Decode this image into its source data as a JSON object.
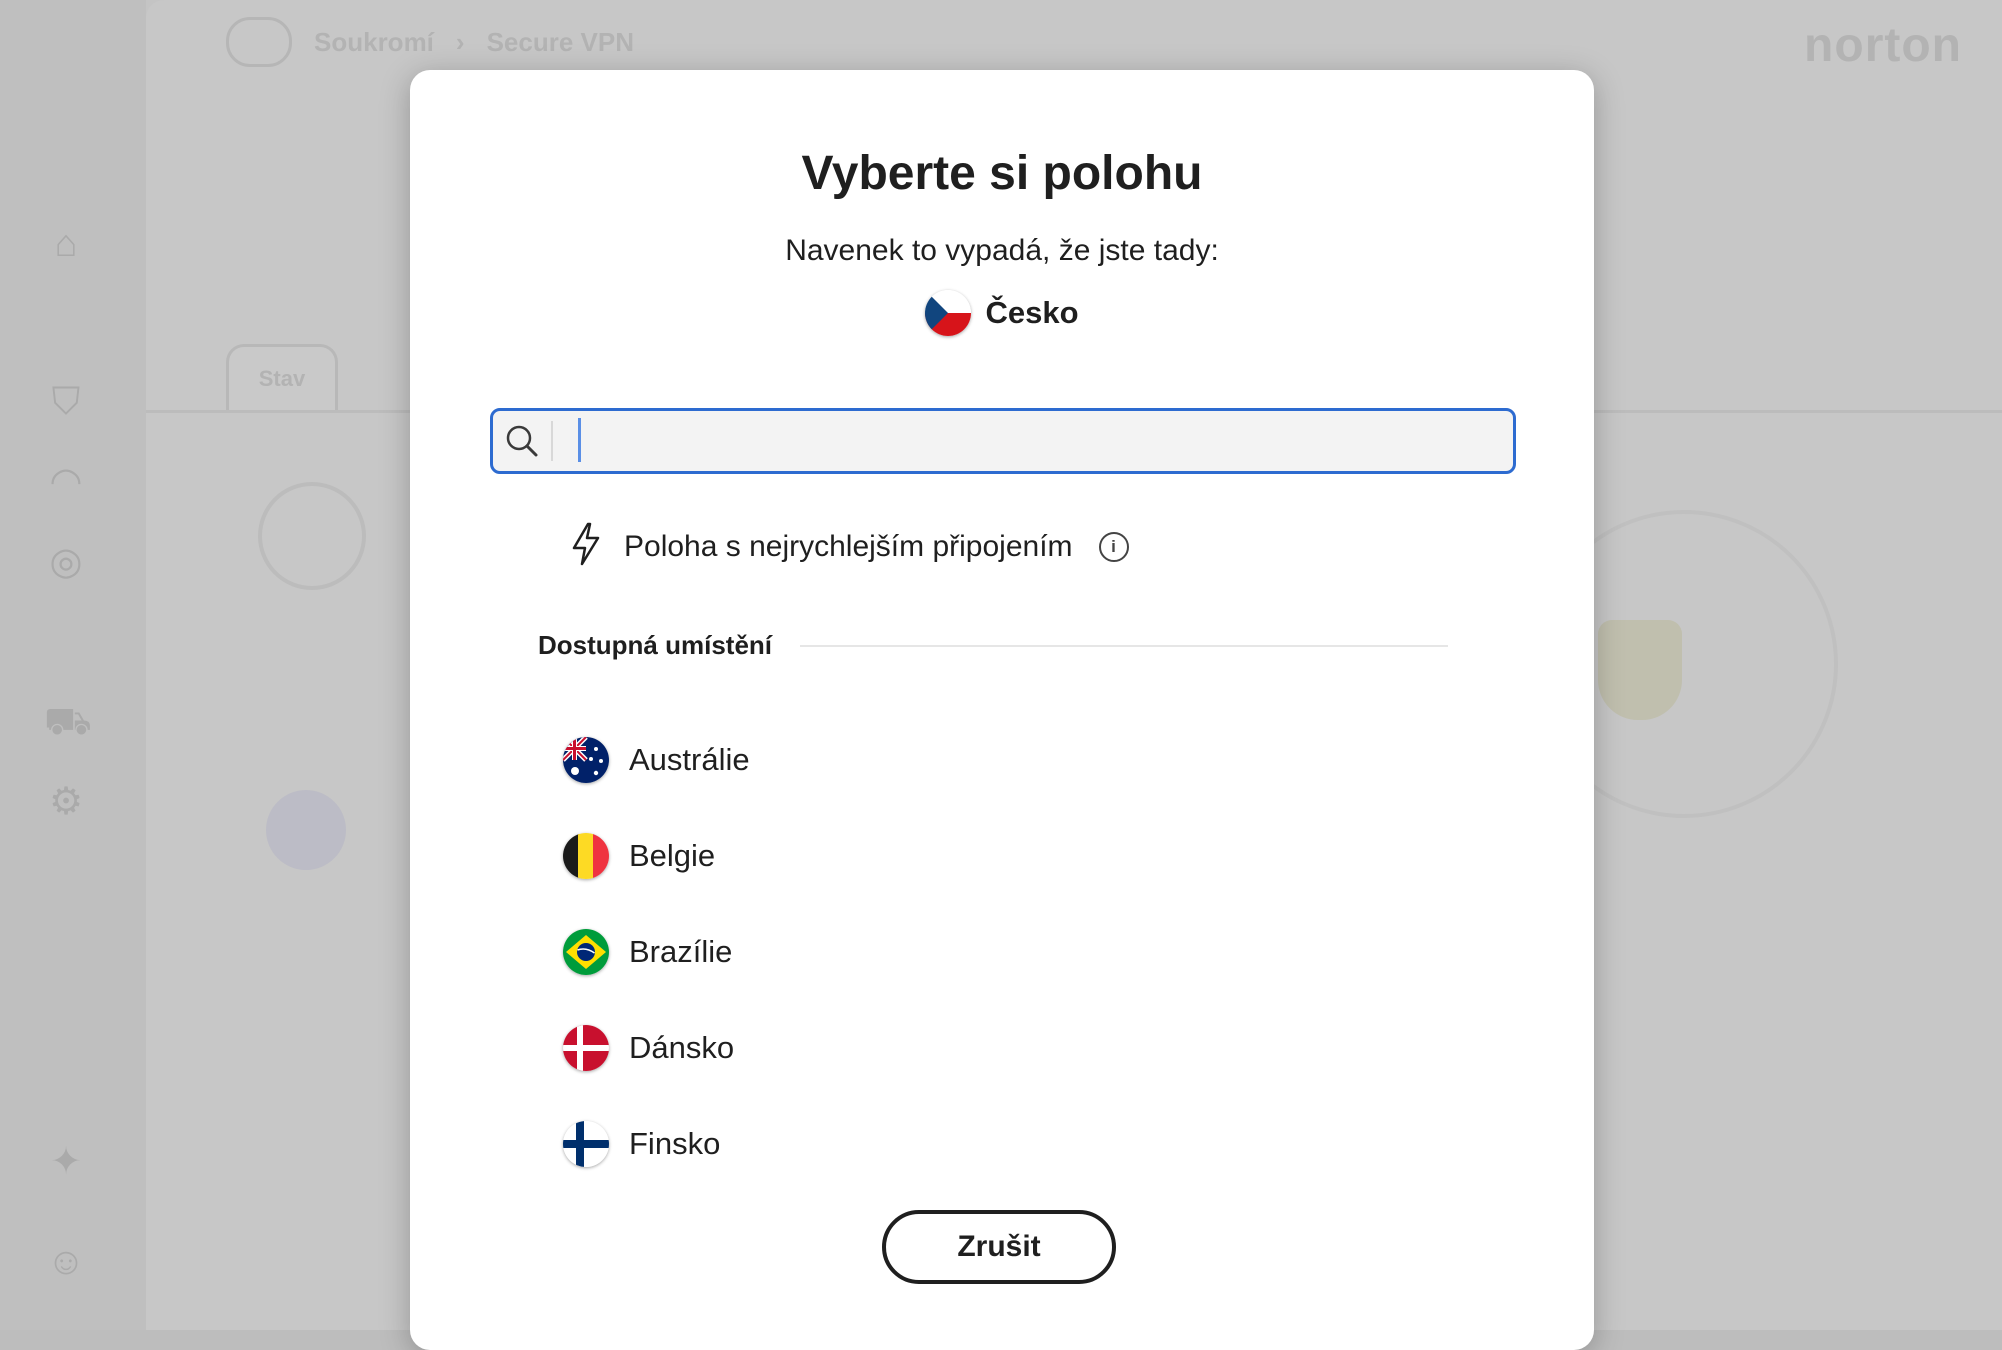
{
  "background": {
    "breadcrumb": [
      "Soukromí",
      "Secure VPN"
    ],
    "brand": "norton",
    "tab_label": "Stav"
  },
  "dialog": {
    "title": "Vyberte si polohu",
    "subtitle": "Navenek to vypadá, že jste tady:",
    "current_location": {
      "name": "Česko",
      "flag": "cz"
    },
    "search": {
      "value": "",
      "placeholder": ""
    },
    "fastest_option": {
      "label": "Poloha s nejrychlejším připojením",
      "icon": "lightning-icon"
    },
    "section_label": "Dostupná umístění",
    "locations": [
      {
        "name": "Austrálie",
        "flag": "au"
      },
      {
        "name": "Belgie",
        "flag": "be"
      },
      {
        "name": "Brazílie",
        "flag": "br"
      },
      {
        "name": "Dánsko",
        "flag": "dk"
      },
      {
        "name": "Finsko",
        "flag": "fi"
      }
    ],
    "cancel_label": "Zrušit"
  },
  "colors": {
    "accent": "#2d6bd0",
    "text": "#1f1f1f",
    "overlay": "#c4c4c4"
  }
}
